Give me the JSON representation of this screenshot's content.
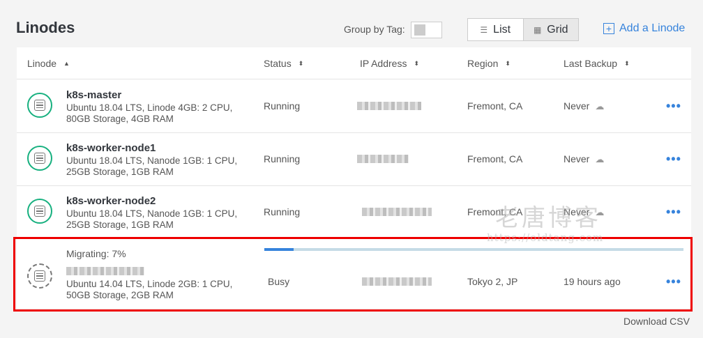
{
  "header": {
    "title": "Linodes",
    "group_by_label": "Group by Tag:",
    "view_list_label": "List",
    "view_grid_label": "Grid",
    "add_label": "Add a Linode",
    "list_icon": "list-icon",
    "grid_icon": "grid-icon",
    "add_icon": "plus-square-icon"
  },
  "table": {
    "columns": [
      "Linode",
      "Status",
      "IP Address",
      "Region",
      "Last Backup"
    ],
    "sort_icon_active": "▲",
    "sort_icon": "⬍",
    "rows": [
      {
        "name": "k8s-master",
        "spec": "Ubuntu 18.04 LTS, Linode 4GB: 2 CPU, 80GB Storage, 4GB RAM",
        "status": "Running",
        "region": "Fremont, CA",
        "backup": "Never"
      },
      {
        "name": "k8s-worker-node1",
        "spec": "Ubuntu 18.04 LTS, Nanode 1GB: 1 CPU, 25GB Storage, 1GB RAM",
        "status": "Running",
        "region": "Fremont, CA",
        "backup": "Never"
      },
      {
        "name": "k8s-worker-node2",
        "spec": "Ubuntu 18.04 LTS, Nanode 1GB: 1 CPU, 25GB Storage, 1GB RAM",
        "status": "Running",
        "region": "Fremont, CA",
        "backup": "Never"
      },
      {
        "migrating": "Migrating: 7%",
        "spec": "Ubuntu 14.04 LTS, Linode 2GB: 1 CPU, 50GB Storage, 2GB RAM",
        "status": "Busy",
        "region": "Tokyo 2, JP",
        "backup": "19 hours ago",
        "progress": 0.07
      }
    ],
    "more_label": "•••",
    "cloud_icon": "cloud-upload-icon"
  },
  "footer": {
    "download_csv": "Download CSV"
  },
  "watermark": {
    "cn": "老唐博客",
    "url": "https://oldtang.com"
  },
  "colors": {
    "accent": "#3683dc",
    "running": "#17b07f",
    "highlight": "#ee0000"
  }
}
